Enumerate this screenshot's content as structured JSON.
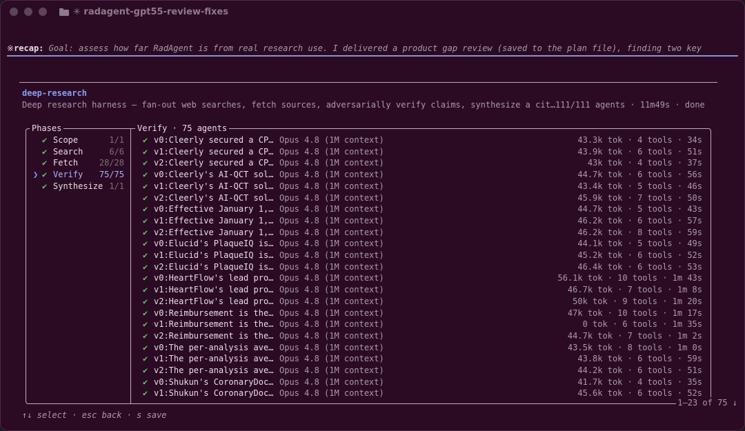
{
  "window": {
    "title": "✳ radagent-gpt55-review-fixes"
  },
  "recap": {
    "symbol": "※",
    "label": "recap:",
    "text": " Goal: assess how far RadAgent is from real research use. I delivered a product gap review (saved to the plan file), finding two key"
  },
  "panel": {
    "name": "deep-research",
    "description": "Deep research harness — fan-out web searches, fetch sources, adversarially verify claims, synthesize a cit…111/111 agents · 11m49s · done"
  },
  "phases": {
    "title": "Phases",
    "items": [
      {
        "name": "Scope",
        "count": "1/1",
        "done": true
      },
      {
        "name": "Search",
        "count": "6/6",
        "done": true
      },
      {
        "name": "Fetch",
        "count": "28/28",
        "done": true
      },
      {
        "name": "Verify",
        "count": "75/75",
        "done": true,
        "selected": true
      },
      {
        "name": "Synthesize",
        "count": "1/1",
        "done": true
      }
    ]
  },
  "verify": {
    "title": "Verify · 75 agents",
    "rows": [
      {
        "name": "v0:Cleerly secured a CP…",
        "model": "Opus 4.8 (1M context)",
        "stats": "43.3k tok · 4 tools · 34s"
      },
      {
        "name": "v1:Cleerly secured a CP…",
        "model": "Opus 4.8 (1M context)",
        "stats": "43.9k tok · 6 tools · 51s"
      },
      {
        "name": "v2:Cleerly secured a CP…",
        "model": "Opus 4.8 (1M context)",
        "stats": "43k tok · 4 tools · 37s"
      },
      {
        "name": "v0:Cleerly's AI-QCT sol…",
        "model": "Opus 4.8 (1M context)",
        "stats": "44.7k tok · 6 tools · 56s"
      },
      {
        "name": "v1:Cleerly's AI-QCT sol…",
        "model": "Opus 4.8 (1M context)",
        "stats": "43.4k tok · 5 tools · 46s"
      },
      {
        "name": "v2:Cleerly's AI-QCT sol…",
        "model": "Opus 4.8 (1M context)",
        "stats": "45.9k tok · 7 tools · 50s"
      },
      {
        "name": "v0:Effective January 1,…",
        "model": "Opus 4.8 (1M context)",
        "stats": "44.7k tok · 5 tools · 43s"
      },
      {
        "name": "v1:Effective January 1,…",
        "model": "Opus 4.8 (1M context)",
        "stats": "46.2k tok · 6 tools · 57s"
      },
      {
        "name": "v2:Effective January 1,…",
        "model": "Opus 4.8 (1M context)",
        "stats": "46.2k tok · 8 tools · 59s"
      },
      {
        "name": "v0:Elucid's PlaqueIQ is…",
        "model": "Opus 4.8 (1M context)",
        "stats": "44.1k tok · 5 tools · 49s"
      },
      {
        "name": "v1:Elucid's PlaqueIQ is…",
        "model": "Opus 4.8 (1M context)",
        "stats": "45.2k tok · 6 tools · 52s"
      },
      {
        "name": "v2:Elucid's PlaqueIQ is…",
        "model": "Opus 4.8 (1M context)",
        "stats": "46.4k tok · 6 tools · 53s"
      },
      {
        "name": "v0:HeartFlow's lead pro…",
        "model": "Opus 4.8 (1M context)",
        "stats": "56.1k tok · 10 tools · 1m 43s"
      },
      {
        "name": "v1:HeartFlow's lead pro…",
        "model": "Opus 4.8 (1M context)",
        "stats": "46.7k tok · 7 tools · 1m 8s"
      },
      {
        "name": "v2:HeartFlow's lead pro…",
        "model": "Opus 4.8 (1M context)",
        "stats": "50k tok · 9 tools · 1m 20s"
      },
      {
        "name": "v0:Reimbursement is the…",
        "model": "Opus 4.8 (1M context)",
        "stats": "47k tok · 10 tools · 1m 17s"
      },
      {
        "name": "v1:Reimbursement is the…",
        "model": "Opus 4.8 (1M context)",
        "stats": "0 tok · 6 tools · 1m 35s"
      },
      {
        "name": "v2:Reimbursement is the…",
        "model": "Opus 4.8 (1M context)",
        "stats": "44.7k tok · 7 tools · 1m 2s"
      },
      {
        "name": "v0:The per-analysis ave…",
        "model": "Opus 4.8 (1M context)",
        "stats": "43.5k tok · 8 tools · 1m 0s"
      },
      {
        "name": "v1:The per-analysis ave…",
        "model": "Opus 4.8 (1M context)",
        "stats": "43.8k tok · 6 tools · 59s"
      },
      {
        "name": "v2:The per-analysis ave…",
        "model": "Opus 4.8 (1M context)",
        "stats": "44.2k tok · 6 tools · 51s"
      },
      {
        "name": "v0:Shukun's CoronaryDoc…",
        "model": "Opus 4.8 (1M context)",
        "stats": "41.7k tok · 4 tools · 35s"
      },
      {
        "name": "v1:Shukun's CoronaryDoc…",
        "model": "Opus 4.8 (1M context)",
        "stats": "45.6k tok · 6 tools · 52s"
      }
    ],
    "pager": "1–23 of 75 ↓"
  },
  "footer": {
    "hints": "↑↓ select · esc back · s save"
  },
  "icons": {
    "check": "✔",
    "caret": "❯",
    "folder": "folder-icon"
  },
  "colors": {
    "background": "#2b0b24",
    "accent": "#8a9ef0",
    "success": "#6cc46c",
    "rule": "#8b8fd8"
  }
}
